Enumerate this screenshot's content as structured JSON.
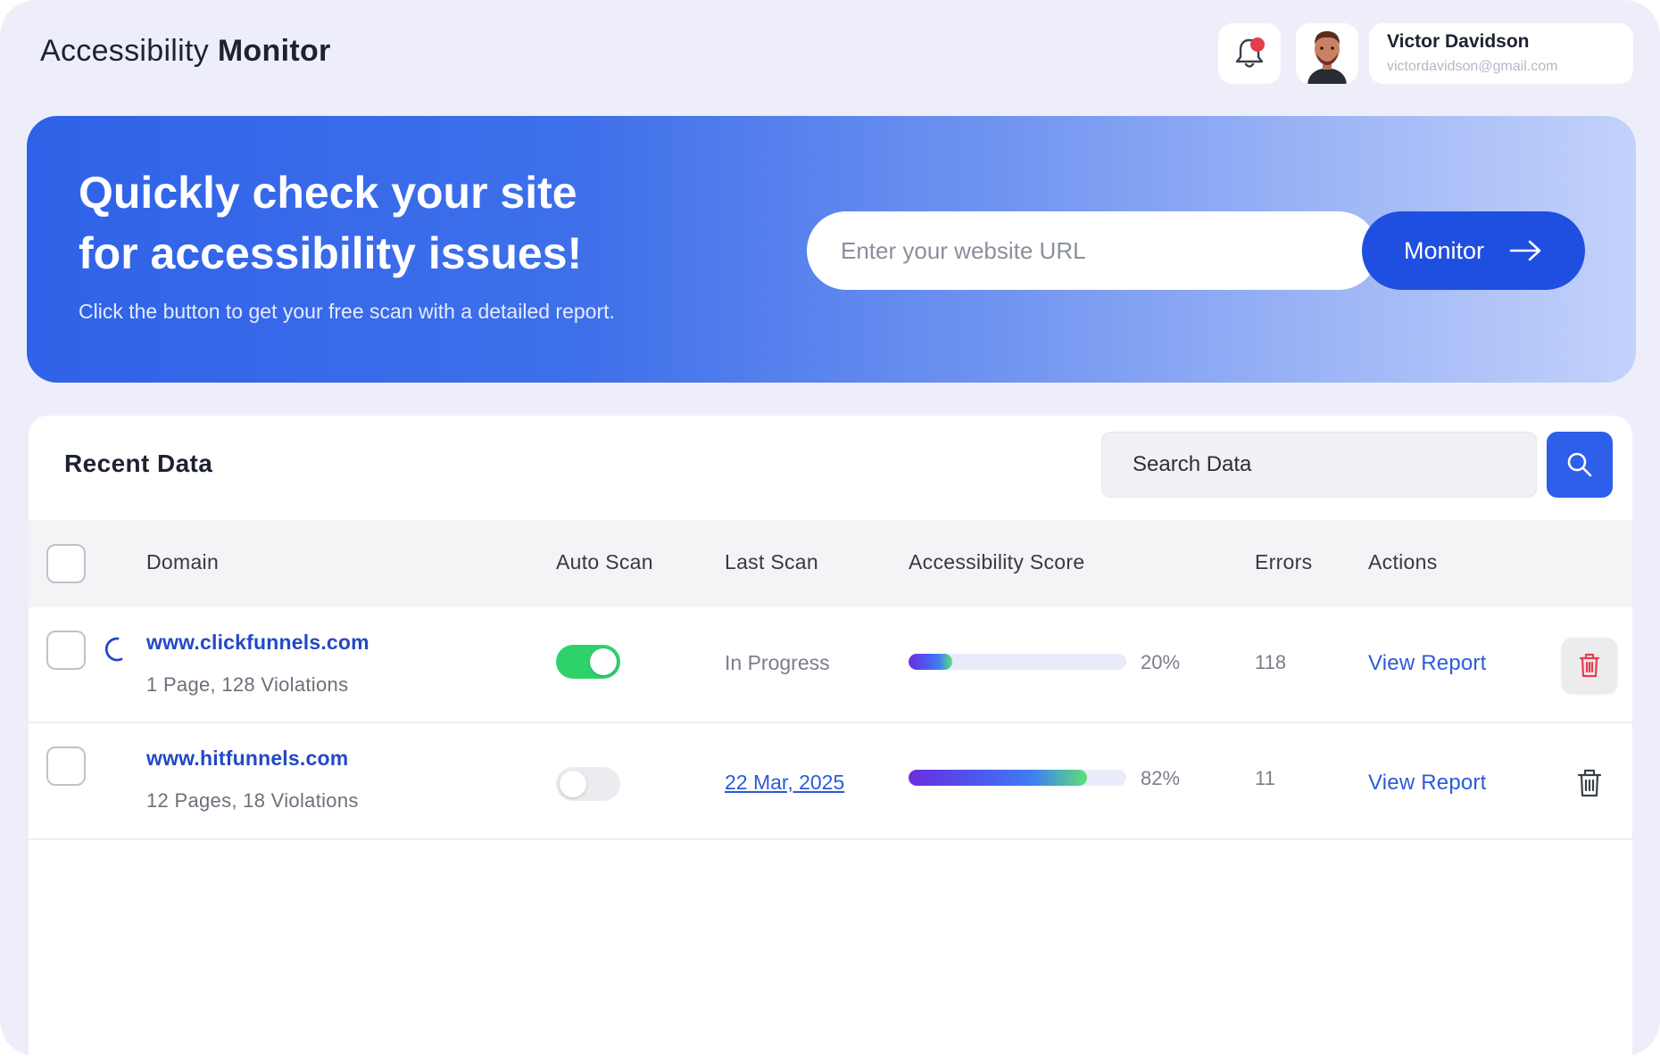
{
  "header": {
    "title_regular": "Accessibility",
    "title_bold": "Monitor",
    "user": {
      "name": "Victor Davidson",
      "email": "victordavidson@gmail.com"
    }
  },
  "hero": {
    "title_line1": "Quickly check your site",
    "title_line2": "for accessibility issues!",
    "subtitle": "Click the button to get your free scan with a detailed report.",
    "url_placeholder": "Enter your website URL",
    "button_label": "Monitor"
  },
  "recent": {
    "title": "Recent Data",
    "search_placeholder": "Search Data",
    "columns": {
      "domain": "Domain",
      "auto_scan": "Auto Scan",
      "last_scan": "Last Scan",
      "score": "Accessibility Score",
      "errors": "Errors",
      "actions": "Actions"
    },
    "rows": [
      {
        "domain": "www.clickfunnels.com",
        "meta": "1 Page, 128 Violations",
        "auto_scan": true,
        "last_scan": "In Progress",
        "score": 20,
        "score_label": "20%",
        "errors": "118",
        "action": "View Report"
      },
      {
        "domain": "www.hitfunnels.com",
        "meta": "12 Pages, 18 Violations",
        "auto_scan": false,
        "last_scan": "22 Mar, 2025",
        "score": 82,
        "score_label": "82%",
        "errors": "11",
        "action": "View Report"
      }
    ]
  },
  "colors": {
    "primary": "#1f4fe0",
    "link": "#2b5ad9",
    "toggle_on": "#2fd26a",
    "danger": "#e43d4b"
  },
  "icons": [
    "bell-icon",
    "avatar",
    "arrow-right-icon",
    "search-icon",
    "spinner-icon",
    "trash-icon"
  ]
}
